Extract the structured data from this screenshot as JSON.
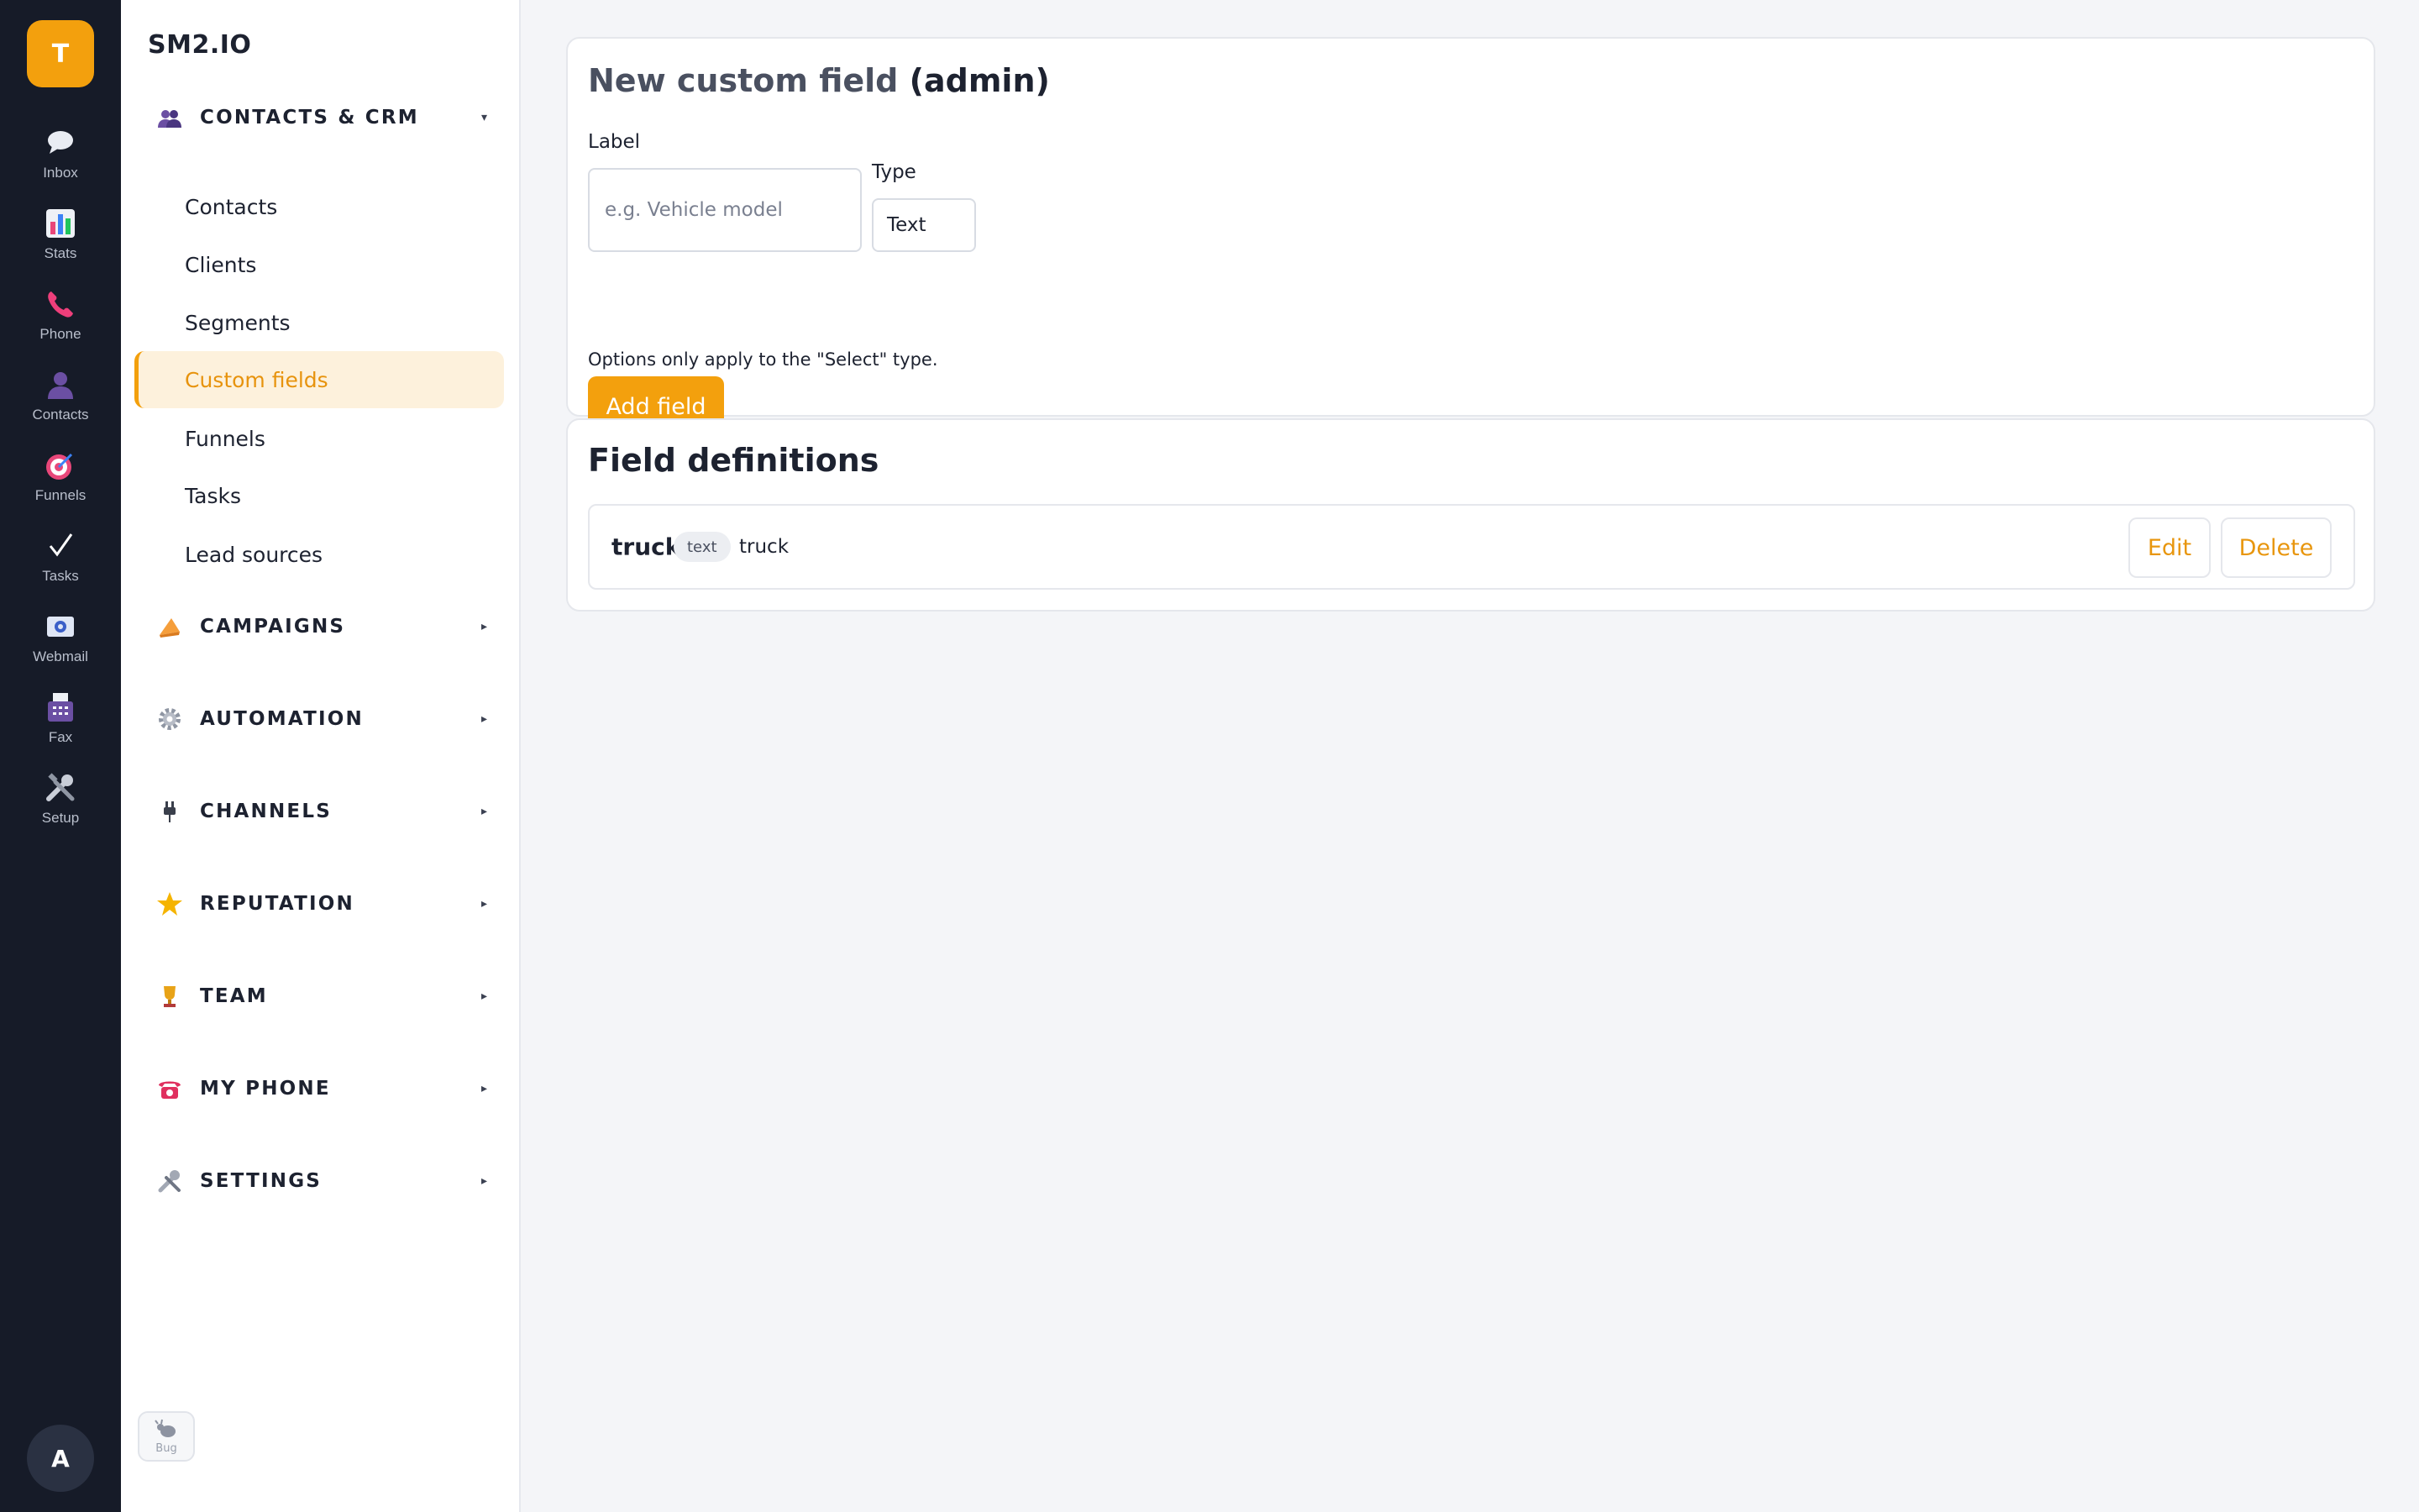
{
  "rail": {
    "badge": "T",
    "items": [
      {
        "label": "Inbox",
        "icon": "speech-bubble-icon"
      },
      {
        "label": "Stats",
        "icon": "bar-chart-icon"
      },
      {
        "label": "Phone",
        "icon": "phone-icon"
      },
      {
        "label": "Contacts",
        "icon": "person-icon"
      },
      {
        "label": "Funnels",
        "icon": "target-icon"
      },
      {
        "label": "Tasks",
        "icon": "check-icon"
      },
      {
        "label": "Webmail",
        "icon": "mail-icon"
      },
      {
        "label": "Fax",
        "icon": "fax-icon"
      },
      {
        "label": "Setup",
        "icon": "tools-icon"
      }
    ],
    "avatar": "A"
  },
  "nav": {
    "brand": "SM2.IO",
    "sections": [
      {
        "label": "CONTACTS & CRM",
        "caret": "▾",
        "icon": "people-icon"
      },
      {
        "label": "CAMPAIGNS",
        "caret": "▸",
        "icon": "megaphone-icon"
      },
      {
        "label": "AUTOMATION",
        "caret": "▸",
        "icon": "gear-icon"
      },
      {
        "label": "CHANNELS",
        "caret": "▸",
        "icon": "plug-icon"
      },
      {
        "label": "REPUTATION",
        "caret": "▸",
        "icon": "star-icon"
      },
      {
        "label": "TEAM",
        "caret": "▸",
        "icon": "trophy-icon"
      },
      {
        "label": "MY PHONE",
        "caret": "▸",
        "icon": "telephone-icon"
      },
      {
        "label": "SETTINGS",
        "caret": "▸",
        "icon": "tools-icon"
      }
    ],
    "sub_items": [
      "Contacts",
      "Clients",
      "Segments",
      "Custom fields",
      "Funnels",
      "Tasks",
      "Lead sources"
    ],
    "active_sub_item": "Custom fields",
    "bug_label": "Bug"
  },
  "new_field": {
    "title_prefix": "New custom field",
    "title_suffix": "(admin)",
    "label_caption": "Label",
    "label_placeholder": "e.g. Vehicle model",
    "type_caption": "Type",
    "type_value": "Text",
    "hint": "Options only apply to the \"Select\" type.",
    "add_button": "Add field"
  },
  "definitions": {
    "title": "Field definitions",
    "rows": [
      {
        "name": "truck",
        "type": "text",
        "key": "truck",
        "edit": "Edit",
        "delete": "Delete"
      }
    ]
  },
  "colors": {
    "accent": "#f3a00d",
    "rail_bg": "#161b28",
    "page_bg": "#f4f5f8"
  }
}
